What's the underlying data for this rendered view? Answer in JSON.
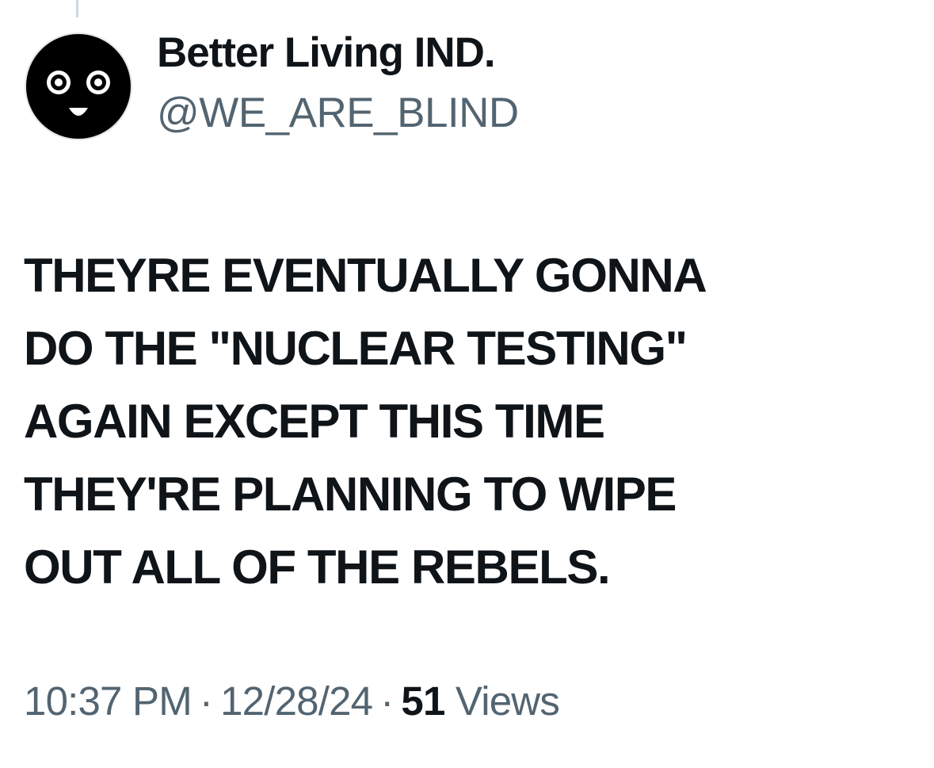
{
  "author": {
    "display_name": "Better Living IND.",
    "handle": "@WE_ARE_BLIND",
    "avatar_icon": "smiley-face-avatar-icon"
  },
  "tweet": {
    "lines": [
      "THEYRE EVENTUALLY GONNA",
      "DO THE \"NUCLEAR TESTING\"",
      "AGAIN EXCEPT THIS TIME",
      "THEY'RE PLANNING TO WIPE",
      "OUT ALL OF THE REBELS."
    ]
  },
  "meta": {
    "time": "10:37 PM",
    "separator": "·",
    "date": "12/28/24",
    "views_count": "51",
    "views_label": "Views"
  },
  "colors": {
    "text_primary": "#0f1419",
    "text_secondary": "#536471",
    "thread_line": "#cfd9de"
  }
}
